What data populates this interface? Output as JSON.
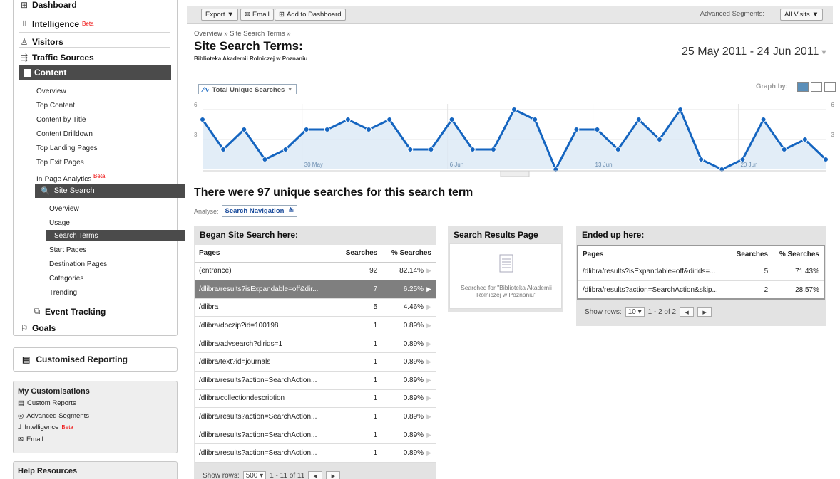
{
  "sidebar": {
    "dashboard": "Dashboard",
    "intelligence": "Intelligence",
    "beta": "Beta",
    "visitors": "Visitors",
    "traffic_sources": "Traffic Sources",
    "content": "Content",
    "content_items": [
      "Overview",
      "Top Content",
      "Content by Title",
      "Content Drilldown",
      "Top Landing Pages",
      "Top Exit Pages",
      "In-Page Analytics"
    ],
    "site_search": "Site Search",
    "site_search_items": [
      "Overview",
      "Usage",
      "Search Terms",
      "Start Pages",
      "Destination Pages",
      "Categories",
      "Trending"
    ],
    "event_tracking": "Event Tracking",
    "goals": "Goals",
    "customised_reporting": "Customised Reporting",
    "my_customisations": "My Customisations",
    "custom_reports": "Custom Reports",
    "advanced_segments": "Advanced Segments",
    "intelligence_small": "Intelligence",
    "email": "Email",
    "help_resources": "Help Resources"
  },
  "toolbar": {
    "export": "Export",
    "email": "Email",
    "add_to_dashboard": "Add to Dashboard",
    "advanced_segments_label": "Advanced Segments:",
    "advanced_segments_value": "All Visits"
  },
  "header": {
    "breadcrumb": "Overview » Site Search Terms »",
    "title": "Site Search Terms:",
    "subtitle": "Biblioteka Akademii Rolniczej w Poznaniu",
    "date_range": "25 May 2011 - 24 Jun 2011"
  },
  "graph": {
    "metric": "Total Unique Searches",
    "graph_by": "Graph by:",
    "line_color": "#1565c0",
    "fill_color": "#dbe9f5"
  },
  "chart_data": {
    "type": "area",
    "series": [
      {
        "name": "Total Unique Searches",
        "values": [
          5,
          2,
          4,
          1,
          2,
          4,
          4,
          5,
          4,
          5,
          2,
          2,
          5,
          2,
          2,
          6,
          5,
          0,
          4,
          4,
          2,
          5,
          3,
          6,
          1,
          0,
          1,
          5,
          2,
          3,
          1
        ]
      }
    ],
    "x_tick_labels": [
      "30 May",
      "6 Jun",
      "13 Jun",
      "20 Jun"
    ],
    "y_tick_labels": [
      "6",
      "3"
    ],
    "ylim": [
      0,
      6
    ],
    "grid": true
  },
  "summary": {
    "headline": "There were 97 unique searches for this search term",
    "analyse_label": "Analyse:",
    "analyse_value": "Search Navigation"
  },
  "began": {
    "title": "Began Site Search here:",
    "columns": [
      "Pages",
      "Searches",
      "% Searches"
    ],
    "rows": [
      {
        "page": "(entrance)",
        "searches": "92",
        "pct": "82.14%"
      },
      {
        "page": "/dlibra/results?isExpandable=off&dir...",
        "searches": "7",
        "pct": "6.25%"
      },
      {
        "page": "/dlibra",
        "searches": "5",
        "pct": "4.46%"
      },
      {
        "page": "/dlibra/doczip?id=100198",
        "searches": "1",
        "pct": "0.89%"
      },
      {
        "page": "/dlibra/advsearch?dirids=1",
        "searches": "1",
        "pct": "0.89%"
      },
      {
        "page": "/dlibra/text?id=journals",
        "searches": "1",
        "pct": "0.89%"
      },
      {
        "page": "/dlibra/results?action=SearchAction...",
        "searches": "1",
        "pct": "0.89%"
      },
      {
        "page": "/dlibra/collectiondescription",
        "searches": "1",
        "pct": "0.89%"
      },
      {
        "page": "/dlibra/results?action=SearchAction...",
        "searches": "1",
        "pct": "0.89%"
      },
      {
        "page": "/dlibra/results?action=SearchAction...",
        "searches": "1",
        "pct": "0.89%"
      },
      {
        "page": "/dlibra/results?action=SearchAction...",
        "searches": "1",
        "pct": "0.89%"
      }
    ],
    "show_rows_label": "Show rows:",
    "show_rows_value": "500",
    "range": "1 - 11 of 11"
  },
  "results_page": {
    "title": "Search Results Page",
    "text": "Searched for \"Biblioteka Akademii Rolniczej w Poznaniu\""
  },
  "ended": {
    "title": "Ended up here:",
    "columns": [
      "Pages",
      "Searches",
      "% Searches"
    ],
    "rows": [
      {
        "page": "/dlibra/results?isExpandable=off&dirids=...",
        "searches": "5",
        "pct": "71.43%"
      },
      {
        "page": "/dlibra/results?action=SearchAction&skip...",
        "searches": "2",
        "pct": "28.57%"
      }
    ],
    "show_rows_label": "Show rows:",
    "show_rows_value": "10",
    "range": "1 - 2 of 2"
  }
}
